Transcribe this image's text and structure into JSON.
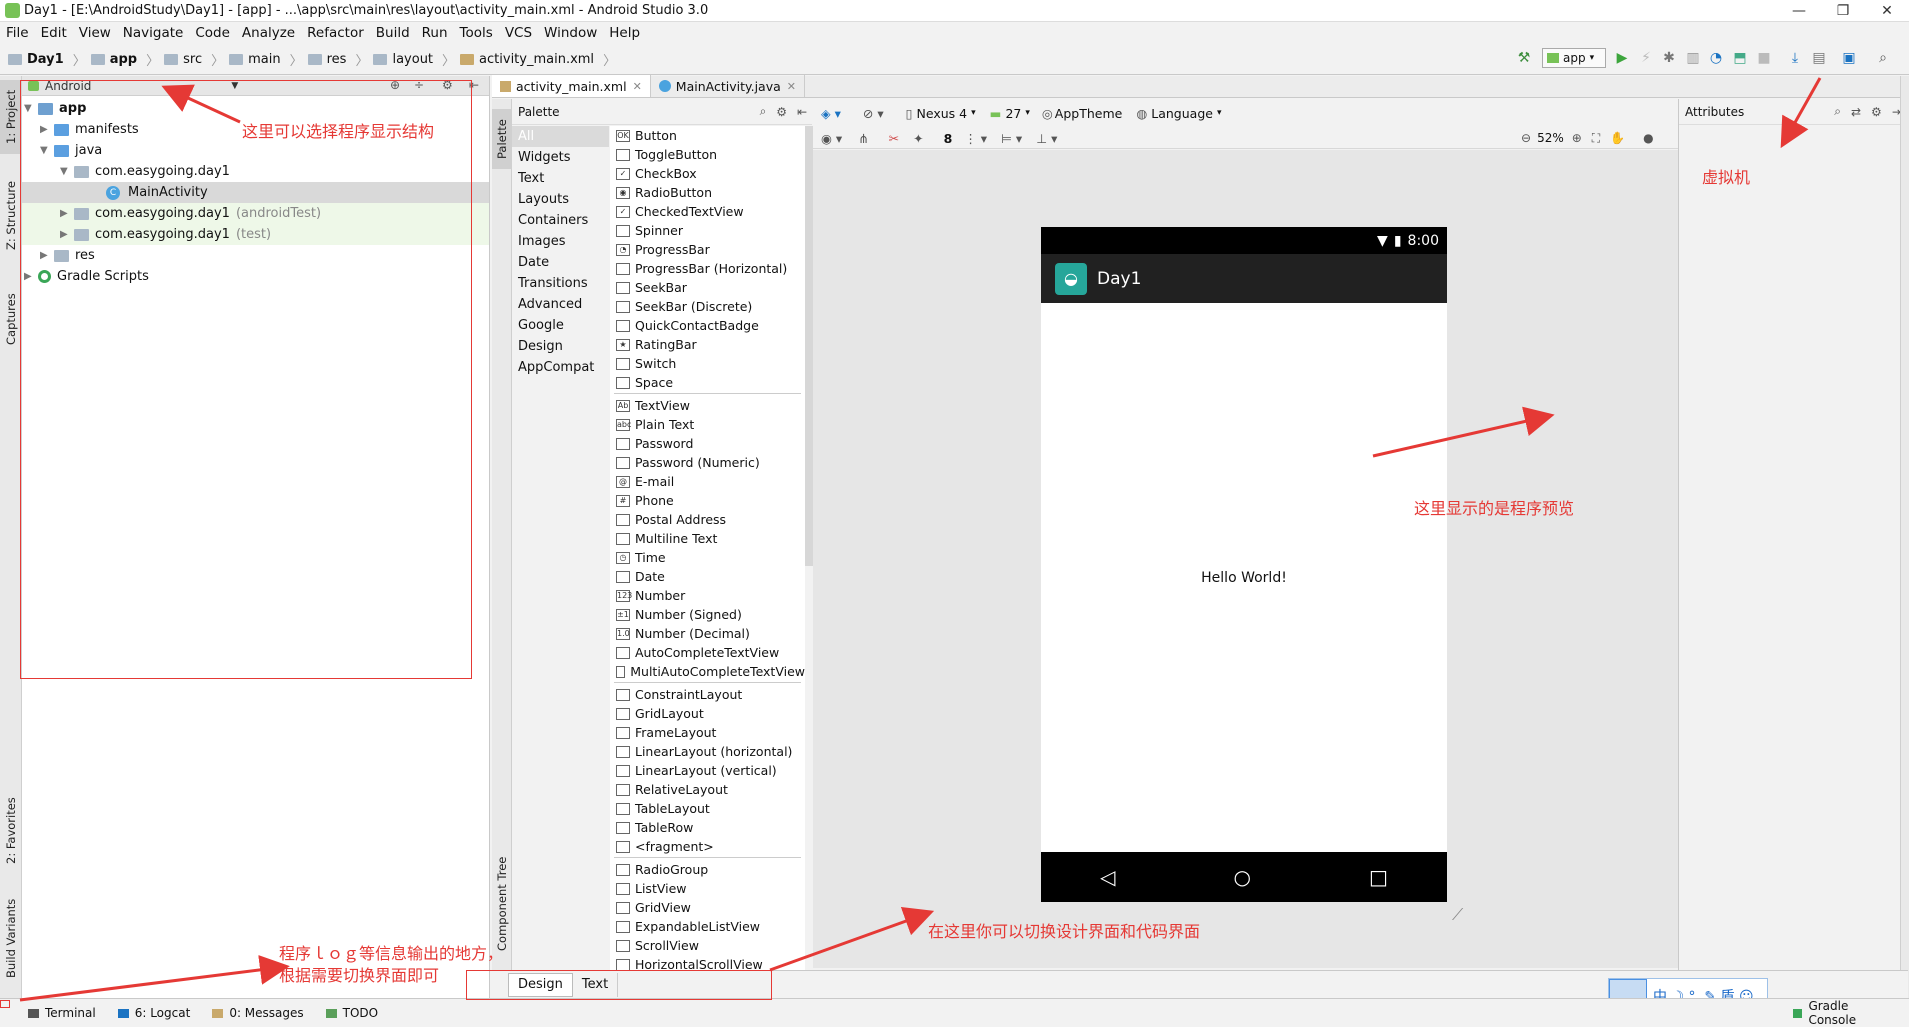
{
  "window": {
    "title": "Day1 - [E:\\AndroidStudy\\Day1] - [app] - ...\\app\\src\\main\\res\\layout\\activity_main.xml - Android Studio 3.0"
  },
  "menu": [
    "File",
    "Edit",
    "View",
    "Navigate",
    "Code",
    "Analyze",
    "Refactor",
    "Build",
    "Run",
    "Tools",
    "VCS",
    "Window",
    "Help"
  ],
  "breadcrumb": [
    "Day1",
    "app",
    "src",
    "main",
    "res",
    "layout",
    "activity_main.xml"
  ],
  "toolbar": {
    "run_config": "app"
  },
  "left_tabs": {
    "project": "1: Project",
    "structure": "Z: Structure",
    "captures": "Captures",
    "favorites": "2: Favorites",
    "build_variants": "Build Variants"
  },
  "project_panel": {
    "view_selector": "Android",
    "tree": [
      {
        "label": "app",
        "bold": true
      },
      {
        "label": "manifests"
      },
      {
        "label": "java"
      },
      {
        "label": "com.easygoing.day1"
      },
      {
        "label": "MainActivity"
      },
      {
        "label": "com.easygoing.day1",
        "suffix": "(androidTest)"
      },
      {
        "label": "com.easygoing.day1",
        "suffix": "(test)"
      },
      {
        "label": "res"
      },
      {
        "label": "Gradle Scripts"
      }
    ]
  },
  "editor_tabs": [
    "activity_main.xml",
    "MainActivity.java"
  ],
  "palette_strip": {
    "palette": "Palette",
    "component_tree": "Component Tree"
  },
  "palette": {
    "title": "Palette",
    "categories": [
      "All",
      "Widgets",
      "Text",
      "Layouts",
      "Containers",
      "Images",
      "Date",
      "Transitions",
      "Advanced",
      "Google",
      "Design",
      "AppCompat"
    ],
    "groups": [
      [
        [
          "OK",
          "Button"
        ],
        [
          "",
          "ToggleButton"
        ],
        [
          "✓",
          "CheckBox"
        ],
        [
          "◉",
          "RadioButton"
        ],
        [
          "✓",
          "CheckedTextView"
        ],
        [
          "",
          "Spinner"
        ],
        [
          "◔",
          "ProgressBar"
        ],
        [
          "",
          "ProgressBar (Horizontal)"
        ],
        [
          "",
          "SeekBar"
        ],
        [
          "",
          "SeekBar (Discrete)"
        ],
        [
          "",
          "QuickContactBadge"
        ],
        [
          "★",
          "RatingBar"
        ],
        [
          "",
          "Switch"
        ],
        [
          "",
          "Space"
        ]
      ],
      [
        [
          "Ab",
          "TextView"
        ],
        [
          "abc",
          "Plain Text"
        ],
        [
          "",
          "Password"
        ],
        [
          "",
          "Password (Numeric)"
        ],
        [
          "@",
          "E-mail"
        ],
        [
          "#",
          "Phone"
        ],
        [
          "",
          "Postal Address"
        ],
        [
          "",
          "Multiline Text"
        ],
        [
          "◷",
          "Time"
        ],
        [
          "",
          "Date"
        ],
        [
          "123",
          "Number"
        ],
        [
          "±1",
          "Number (Signed)"
        ],
        [
          "1.0",
          "Number (Decimal)"
        ],
        [
          "",
          "AutoCompleteTextView"
        ],
        [
          "",
          "MultiAutoCompleteTextView"
        ]
      ],
      [
        [
          "",
          "ConstraintLayout"
        ],
        [
          "",
          "GridLayout"
        ],
        [
          "",
          "FrameLayout"
        ],
        [
          "",
          "LinearLayout (horizontal)"
        ],
        [
          "",
          "LinearLayout (vertical)"
        ],
        [
          "",
          "RelativeLayout"
        ],
        [
          "",
          "TableLayout"
        ],
        [
          "",
          "TableRow"
        ],
        [
          "",
          "<fragment>"
        ]
      ],
      [
        [
          "",
          "RadioGroup"
        ],
        [
          "",
          "ListView"
        ],
        [
          "",
          "GridView"
        ],
        [
          "",
          "ExpandableListView"
        ],
        [
          "",
          "ScrollView"
        ],
        [
          "",
          "HorizontalScrollView"
        ]
      ]
    ]
  },
  "design_toolbar": {
    "device": "Nexus 4",
    "api": "27",
    "theme": "AppTheme",
    "language": "Language",
    "margin": "8",
    "zoom": "52%"
  },
  "attributes": {
    "title": "Attributes"
  },
  "preview": {
    "status_time": "8:00",
    "app_title": "Day1",
    "hello": "Hello World!"
  },
  "design_tabs": [
    "Design",
    "Text"
  ],
  "bottom_tabs": [
    "Terminal",
    "6: Logcat",
    "0: Messages",
    "TODO"
  ],
  "gradle_console": "Gradle Console",
  "ime": "中 ☽ °, ✎ 盾 ☺",
  "annotations": {
    "structure": "这里可以选择程序显示结构",
    "emulator": "虚拟机",
    "preview": "这里显示的是程序预览",
    "switch": "在这里你可以切换设计界面和代码界面",
    "log_line1": "程序ｌｏｇ等信息输出的地方，",
    "log_line2": "根据需要切换界面即可"
  },
  "colors": {
    "annotation": "#e53935",
    "android_green": "#78c257",
    "teal": "#26a69a",
    "selection": "#d9d9d9",
    "test_bg": "#eef8e8"
  }
}
